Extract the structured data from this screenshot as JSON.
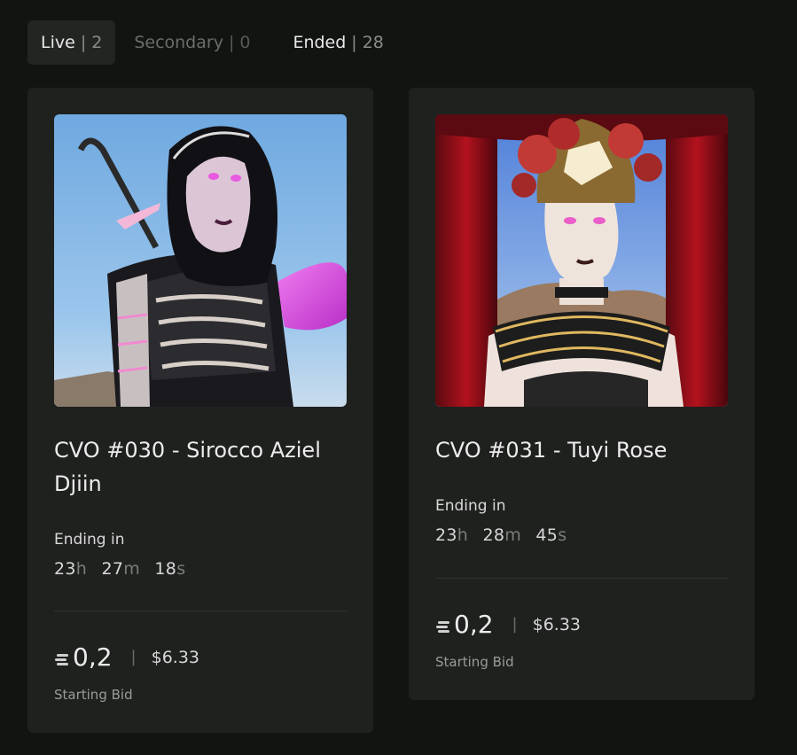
{
  "tabs": [
    {
      "label": "Live",
      "separator": "|",
      "count": "2"
    },
    {
      "label": "Secondary",
      "separator": "|",
      "count": "0"
    },
    {
      "label": "Ended",
      "separator": "|",
      "count": "28"
    }
  ],
  "cards": [
    {
      "title": "CVO #030 - Sirocco Aziel Djiin",
      "ending_label": "Ending in",
      "countdown": {
        "h": "23",
        "h_unit": "h",
        "m": "27",
        "m_unit": "m",
        "s": "18",
        "s_unit": "s"
      },
      "bid_value": "0,2",
      "separator": "|",
      "usd": "$6.33",
      "bid_label": "Starting Bid"
    },
    {
      "title": "CVO #031 - Tuyi Rose",
      "ending_label": "Ending in",
      "countdown": {
        "h": "23",
        "h_unit": "h",
        "m": "28",
        "m_unit": "m",
        "s": "45",
        "s_unit": "s"
      },
      "bid_value": "0,2",
      "separator": "|",
      "usd": "$6.33",
      "bid_label": "Starting Bid"
    }
  ],
  "colors": {
    "background": "#121412",
    "card": "#1f211f",
    "active_tab": "#232523"
  },
  "icons": {
    "currency": "coin-stack-icon"
  }
}
